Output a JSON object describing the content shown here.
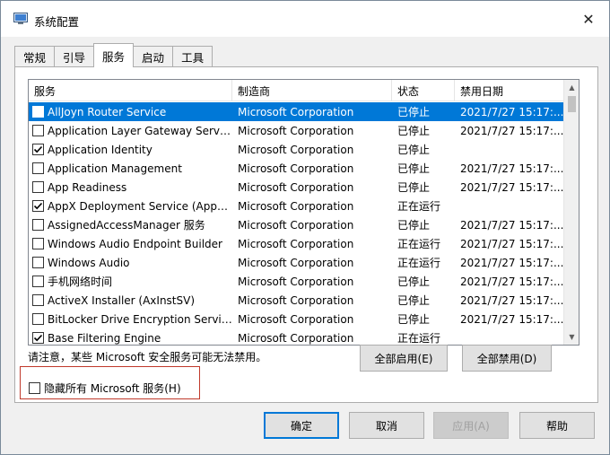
{
  "window": {
    "title": "系统配置",
    "close_glyph": "✕"
  },
  "tabs": [
    {
      "label": "常规",
      "active": false
    },
    {
      "label": "引导",
      "active": false
    },
    {
      "label": "服务",
      "active": true
    },
    {
      "label": "启动",
      "active": false
    },
    {
      "label": "工具",
      "active": false
    }
  ],
  "table": {
    "columns": [
      "服务",
      "制造商",
      "状态",
      "禁用日期"
    ],
    "rows": [
      {
        "service": "AllJoyn Router Service",
        "manufacturer": "Microsoft Corporation",
        "status": "已停止",
        "date": "2021/7/27 15:17:...",
        "checked": false,
        "selected": true
      },
      {
        "service": "Application Layer Gateway Service",
        "manufacturer": "Microsoft Corporation",
        "status": "已停止",
        "date": "2021/7/27 15:17:...",
        "checked": false,
        "selected": false
      },
      {
        "service": "Application Identity",
        "manufacturer": "Microsoft Corporation",
        "status": "已停止",
        "date": "",
        "checked": true,
        "selected": false
      },
      {
        "service": "Application Management",
        "manufacturer": "Microsoft Corporation",
        "status": "已停止",
        "date": "2021/7/27 15:17:...",
        "checked": false,
        "selected": false
      },
      {
        "service": "App Readiness",
        "manufacturer": "Microsoft Corporation",
        "status": "已停止",
        "date": "2021/7/27 15:17:...",
        "checked": false,
        "selected": false
      },
      {
        "service": "AppX Deployment Service (AppX...",
        "manufacturer": "Microsoft Corporation",
        "status": "正在运行",
        "date": "",
        "checked": true,
        "selected": false
      },
      {
        "service": "AssignedAccessManager 服务",
        "manufacturer": "Microsoft Corporation",
        "status": "已停止",
        "date": "2021/7/27 15:17:...",
        "checked": false,
        "selected": false
      },
      {
        "service": "Windows Audio Endpoint Builder",
        "manufacturer": "Microsoft Corporation",
        "status": "正在运行",
        "date": "2021/7/27 15:17:...",
        "checked": false,
        "selected": false
      },
      {
        "service": "Windows Audio",
        "manufacturer": "Microsoft Corporation",
        "status": "正在运行",
        "date": "2021/7/27 15:17:...",
        "checked": false,
        "selected": false
      },
      {
        "service": "手机网络时间",
        "manufacturer": "Microsoft Corporation",
        "status": "已停止",
        "date": "2021/7/27 15:17:...",
        "checked": false,
        "selected": false
      },
      {
        "service": "ActiveX Installer (AxInstSV)",
        "manufacturer": "Microsoft Corporation",
        "status": "已停止",
        "date": "2021/7/27 15:17:...",
        "checked": false,
        "selected": false
      },
      {
        "service": "BitLocker Drive Encryption Service",
        "manufacturer": "Microsoft Corporation",
        "status": "已停止",
        "date": "2021/7/27 15:17:...",
        "checked": false,
        "selected": false
      },
      {
        "service": "Base Filtering Engine",
        "manufacturer": "Microsoft Corporation",
        "status": "正在运行",
        "date": "",
        "checked": true,
        "selected": false
      }
    ]
  },
  "note": "请注意，某些 Microsoft 安全服务可能无法禁用。",
  "buttons": {
    "enable_all": "全部启用(E)",
    "disable_all": "全部禁用(D)",
    "ok": "确定",
    "cancel": "取消",
    "apply": "应用(A)",
    "help": "帮助"
  },
  "hide_ms": {
    "label": "隐藏所有 Microsoft 服务(H)",
    "checked": false
  },
  "colors": {
    "selection": "#0078d7",
    "highlight_box": "#c0392b"
  }
}
